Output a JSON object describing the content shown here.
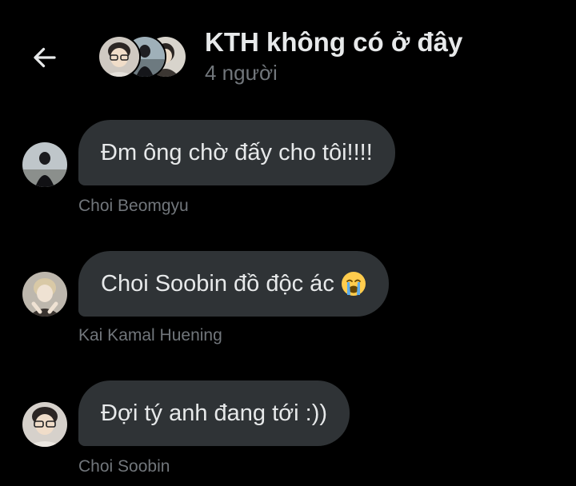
{
  "header": {
    "back_icon": "arrow-left-icon",
    "title": "KTH không có ở đây",
    "subtitle": "4 người"
  },
  "messages": [
    {
      "text": "Đm ông chờ đấy cho tôi!!!!",
      "sender": "Choi Beomgyu"
    },
    {
      "text": "Choi Soobin đồ độc ác",
      "emoji": "loudly-crying-face-icon",
      "sender": "Kai Kamal Huening"
    },
    {
      "text": "Đợi tý anh đang tới :))",
      "sender": "Choi Soobin"
    }
  ],
  "colors": {
    "background": "#000000",
    "bubble": "#2f3336",
    "primary_text": "#e7e9ea",
    "secondary_text": "#71767b"
  }
}
